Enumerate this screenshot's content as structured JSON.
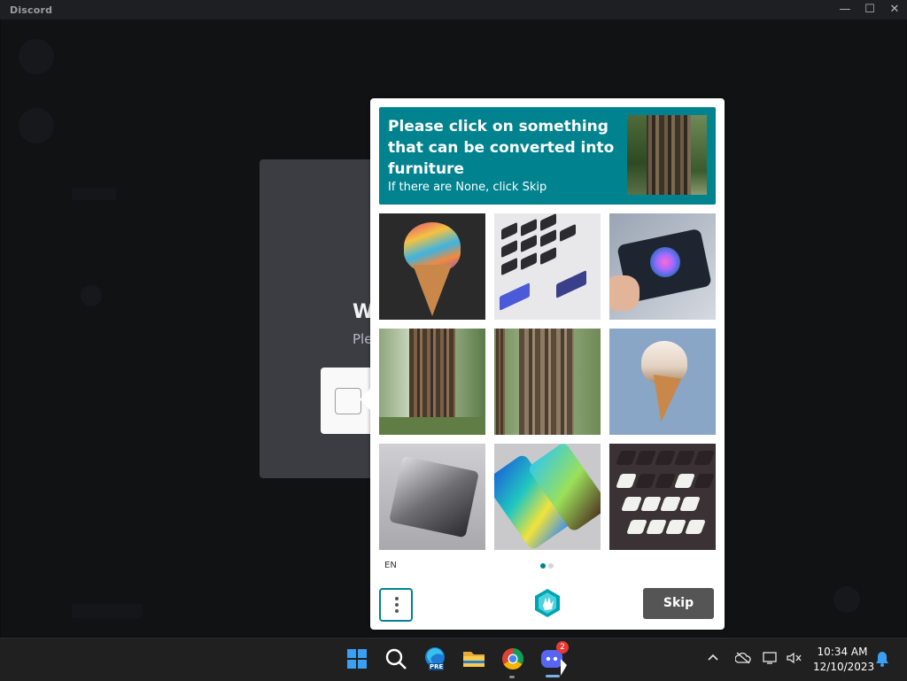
{
  "window": {
    "title": "Discord",
    "controls": {
      "minimize": "—",
      "maximize": "☐",
      "close": "✕"
    }
  },
  "background_dialog": {
    "title_fragment": "W",
    "subtitle_fragment": "Ple"
  },
  "captcha": {
    "prompt": {
      "title": "Please click on something that can be converted into furniture",
      "subtitle": "If there are None, click Skip",
      "reference_image": "tree-trunk-forest"
    },
    "images": [
      {
        "subject": "rainbow-ice-cream-cone"
      },
      {
        "subject": "keyboard-and-phones"
      },
      {
        "subject": "tablet-in-hands"
      },
      {
        "subject": "tree-trunk"
      },
      {
        "subject": "tree-trunks-forest"
      },
      {
        "subject": "soft-serve-ice-cream-cone"
      },
      {
        "subject": "tablet"
      },
      {
        "subject": "colorful-phones"
      },
      {
        "subject": "keyboard"
      }
    ],
    "language": "EN",
    "page": {
      "current": 1,
      "total": 2
    },
    "menu_icon": "vertical-dots-icon",
    "logo_icon": "hcaptcha-logo-icon",
    "skip_label": "Skip",
    "accent_color": "#00838f"
  },
  "taskbar": {
    "apps": [
      {
        "name": "start-button",
        "icon": "windows-logo-icon"
      },
      {
        "name": "search",
        "icon": "search-icon"
      },
      {
        "name": "edge-beta",
        "icon": "edge-beta-icon",
        "badge_text": "PRE"
      },
      {
        "name": "file-explorer",
        "icon": "folder-icon"
      },
      {
        "name": "chrome",
        "icon": "chrome-icon"
      },
      {
        "name": "discord",
        "icon": "discord-icon",
        "badge": "2"
      }
    ],
    "tray": {
      "overflow_icon": "chevron-up-icon",
      "onedrive_icon": "cloud-offline-icon",
      "network_icon": "network-icon",
      "volume_icon": "volume-muted-icon",
      "notification_icon": "bell-icon"
    },
    "clock": {
      "time": "10:34 AM",
      "date": "12/10/2023"
    }
  }
}
